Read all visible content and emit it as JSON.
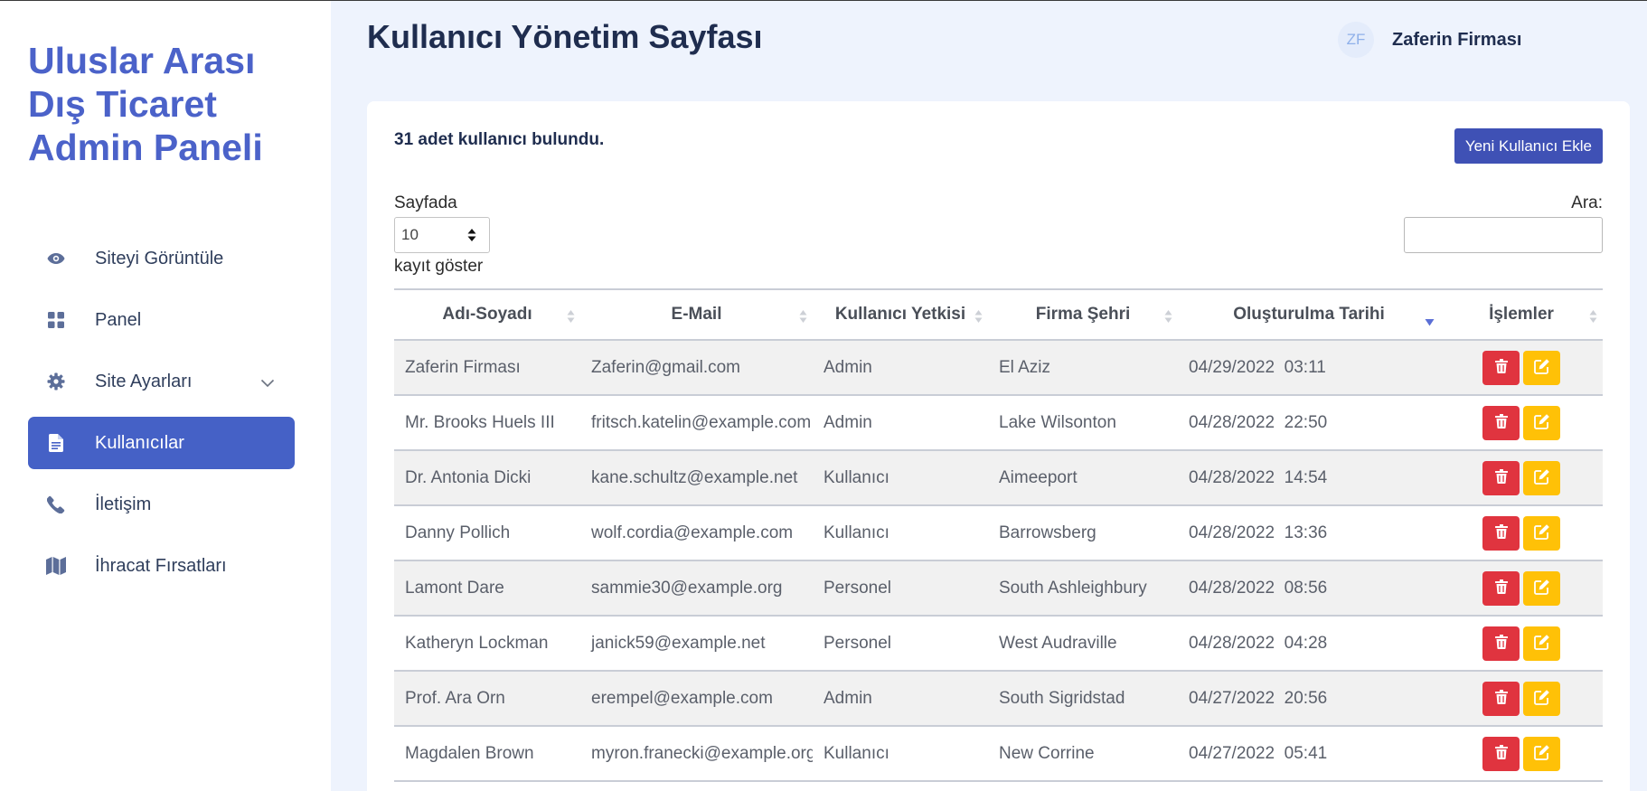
{
  "brand": {
    "title": "Uluslar Arası Dış Ticaret Admin Paneli"
  },
  "sidebar": {
    "items": [
      {
        "label": "Siteyi Görüntüle",
        "icon": "eye-icon"
      },
      {
        "label": "Panel",
        "icon": "grid-icon"
      },
      {
        "label": "Site Ayarları",
        "icon": "gear-icon"
      },
      {
        "label": "Kullanıcılar",
        "icon": "document-icon",
        "active": true
      },
      {
        "label": "İletişim",
        "icon": "phone-icon"
      },
      {
        "label": "İhracat Fırsatları",
        "icon": "map-icon"
      }
    ]
  },
  "header": {
    "title": "Kullanıcı Yönetim Sayfası",
    "user_initials": "ZF",
    "user_name": "Zaferin Firması"
  },
  "card": {
    "count_text": "31 adet kullanıcı bulundu.",
    "add_button": "Yeni Kullanıcı Ekle",
    "length_label_1": "Sayfada",
    "length_value": "10",
    "length_label_2": "kayıt göster",
    "search_label": "Ara:",
    "search_value": ""
  },
  "table": {
    "columns": [
      "Adı-Soyadı",
      "E-Mail",
      "Kullanıcı Yetkisi",
      "Firma Şehri",
      "Oluşturulma Tarihi",
      "İşlemler"
    ],
    "rows": [
      {
        "name": "Zaferin Firması",
        "email": "Zaferin@gmail.com",
        "role": "Admin",
        "city": "El Aziz",
        "date": "04/29/2022  03:11"
      },
      {
        "name": "Mr. Brooks Huels III",
        "email": "fritsch.katelin@example.com",
        "role": "Admin",
        "city": "Lake Wilsonton",
        "date": "04/28/2022  22:50"
      },
      {
        "name": "Dr. Antonia Dicki",
        "email": "kane.schultz@example.net",
        "role": "Kullanıcı",
        "city": "Aimeeport",
        "date": "04/28/2022  14:54"
      },
      {
        "name": "Danny Pollich",
        "email": "wolf.cordia@example.com",
        "role": "Kullanıcı",
        "city": "Barrowsberg",
        "date": "04/28/2022  13:36"
      },
      {
        "name": "Lamont Dare",
        "email": "sammie30@example.org",
        "role": "Personel",
        "city": "South Ashleighbury",
        "date": "04/28/2022  08:56"
      },
      {
        "name": "Katheryn Lockman",
        "email": "janick59@example.net",
        "role": "Personel",
        "city": "West Audraville",
        "date": "04/28/2022  04:28"
      },
      {
        "name": "Prof. Ara Orn",
        "email": "erempel@example.com",
        "role": "Admin",
        "city": "South Sigridstad",
        "date": "04/27/2022  20:56"
      },
      {
        "name": "Magdalen Brown",
        "email": "myron.franecki@example.org",
        "role": "Kullanıcı",
        "city": "New Corrine",
        "date": "04/27/2022  05:41"
      }
    ]
  },
  "colors": {
    "brand": "#4b62c9",
    "active_nav": "#4561c6",
    "add_button": "#3f51b5",
    "delete": "#e0343f",
    "edit": "#ffc107"
  }
}
